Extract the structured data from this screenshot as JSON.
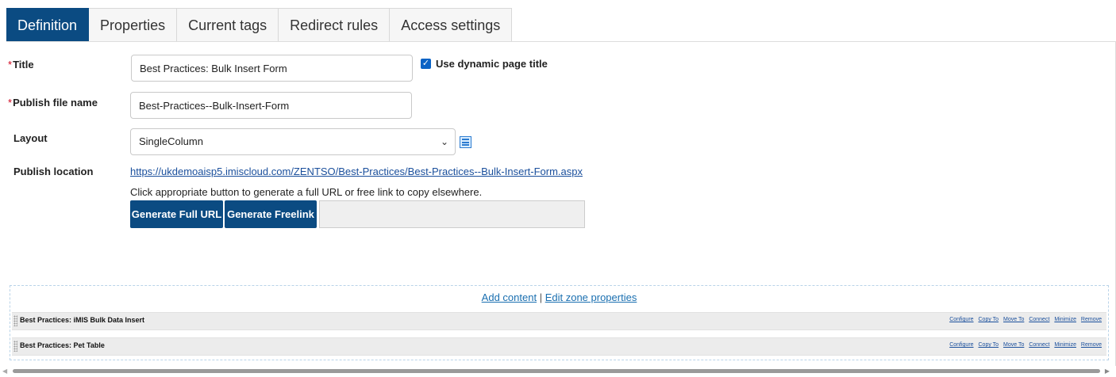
{
  "tabs": [
    "Definition",
    "Properties",
    "Current tags",
    "Redirect rules",
    "Access settings"
  ],
  "form": {
    "title_label": "Title",
    "title_value": "Best Practices: Bulk Insert Form",
    "dynamic_title_label": "Use dynamic page title",
    "dynamic_title_checked": true,
    "publish_file_label": "Publish file name",
    "publish_file_value": "Best-Practices--Bulk-Insert-Form",
    "layout_label": "Layout",
    "layout_value": "SingleColumn",
    "publish_location_label": "Publish location",
    "publish_location_url": "https://ukdemoaisp5.imiscloud.com/ZENTSO/Best-Practices/Best-Practices--Bulk-Insert-Form.aspx",
    "hint": "Click appropriate button to generate a full URL or free link to copy elsewhere.",
    "generate_full_url": "Generate Full URL",
    "generate_freelink": "Generate Freelink",
    "generated_link_value": ""
  },
  "zone": {
    "add_content": "Add content",
    "separator": "|",
    "edit_zone_properties": "Edit zone properties",
    "parts": [
      {
        "title": "Best Practices: iMIS Bulk Data Insert"
      },
      {
        "title": "Best Practices: Pet Table"
      }
    ],
    "actions": [
      "Configure",
      "Copy To",
      "Move To",
      "Connect",
      "Minimize",
      "Remove"
    ]
  },
  "colors": {
    "primary": "#0b4b82",
    "link": "#1a4f9c",
    "required": "#d0021b"
  }
}
